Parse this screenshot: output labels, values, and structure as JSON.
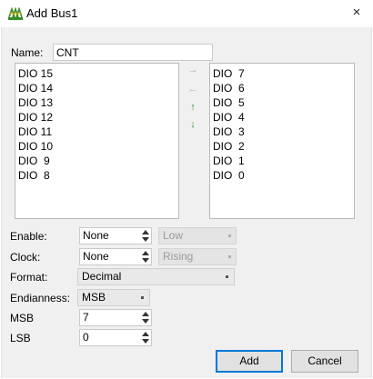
{
  "window": {
    "title": "Add Bus1",
    "close_glyph": "×"
  },
  "name": {
    "label": "Name:",
    "value": "CNT"
  },
  "available_list": [
    "DIO 15",
    "DIO 14",
    "DIO 13",
    "DIO 12",
    "DIO 11",
    "DIO 10",
    "DIO  9",
    "DIO  8"
  ],
  "bus_list": [
    "DIO  7",
    "DIO  6",
    "DIO  5",
    "DIO  4",
    "DIO  3",
    "DIO  2",
    "DIO  1",
    "DIO  0"
  ],
  "arrows": {
    "add": "→",
    "remove": "←",
    "move_up": "↑",
    "move_down": "↓",
    "add_color": "#b0b0b0",
    "remove_color": "#b0b0b0",
    "up_color": "#2e9a2e",
    "down_color": "#2e9a2e"
  },
  "enable": {
    "label": "Enable:",
    "value": "None",
    "level": "Low"
  },
  "clock": {
    "label": "Clock:",
    "value": "None",
    "edge": "Rising"
  },
  "format": {
    "label": "Format:",
    "value": "Decimal"
  },
  "endianness": {
    "label": "Endianness:",
    "value": "MSB"
  },
  "msb": {
    "label": "MSB",
    "value": "7"
  },
  "lsb": {
    "label": "LSB",
    "value": "0"
  },
  "buttons": {
    "add": "Add",
    "cancel": "Cancel"
  },
  "colors": {
    "accent": "#0078d7",
    "dialog_bg": "#f0f0f0"
  }
}
